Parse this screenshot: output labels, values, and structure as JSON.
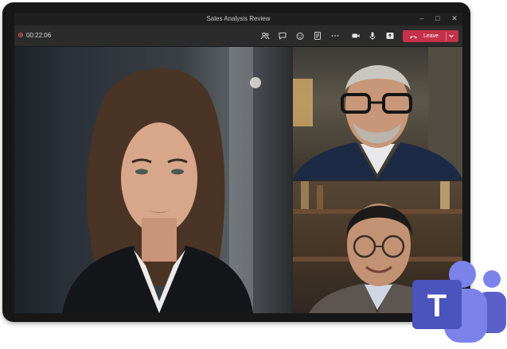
{
  "window": {
    "title": "Sales Analysis Review",
    "controls": [
      "minimize-icon",
      "maximize-icon",
      "close-icon"
    ]
  },
  "toolbar": {
    "timer": "00:22:06",
    "icons": [
      "people-icon",
      "chat-icon",
      "react-icon",
      "notes-icon",
      "more-icon",
      "camera-icon",
      "mic-icon",
      "share-icon"
    ],
    "leave_label": "Leave"
  },
  "participants": [
    {
      "tile": "main",
      "description_icon": "participant-video"
    },
    {
      "tile": "top-right",
      "description_icon": "participant-video"
    },
    {
      "tile": "bottom-right",
      "description_icon": "participant-video"
    }
  ],
  "colors": {
    "leave": "#c4314b",
    "frame": "#171717",
    "toolbar": "#2b2b2b",
    "teams_purple": "#5b5fc7",
    "teams_light": "#7b83eb"
  },
  "logo": {
    "letter": "T"
  }
}
